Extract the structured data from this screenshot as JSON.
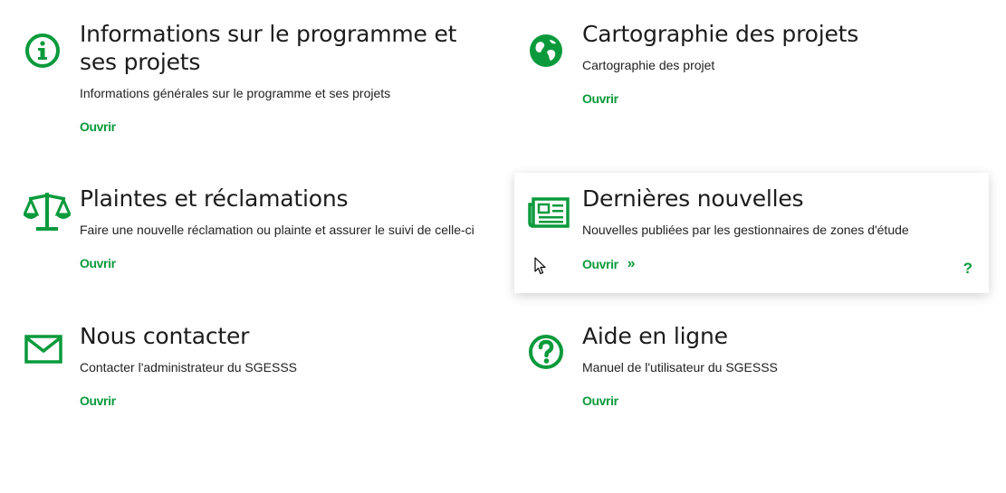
{
  "accent_color": "#0a9a3c",
  "cards": [
    {
      "title": "Informations sur le programme et ses projets",
      "description": "Informations générales sur le programme et ses projets",
      "link": "Ouvrir",
      "icon": "info-circle-icon"
    },
    {
      "title": "Cartographie des projets",
      "description": "Cartographie des projet",
      "link": "Ouvrir",
      "icon": "globe-icon"
    },
    {
      "title": "Plaintes et réclamations",
      "description": "Faire une nouvelle réclamation ou plainte et assurer le suivi de celle-ci",
      "link": "Ouvrir",
      "icon": "balance-scale-icon"
    },
    {
      "title": "Dernières nouvelles",
      "description": "Nouvelles publiées par les gestionnaires de zones d'étude",
      "link": "Ouvrir",
      "chevron": "»",
      "help": "?",
      "icon": "newspaper-icon"
    },
    {
      "title": "Nous contacter",
      "description": "Contacter l'administrateur du SGESSS",
      "link": "Ouvrir",
      "icon": "envelope-icon"
    },
    {
      "title": "Aide en ligne",
      "description": "Manuel de l'utilisateur du SGESSS",
      "link": "Ouvrir",
      "icon": "question-circle-icon"
    }
  ]
}
